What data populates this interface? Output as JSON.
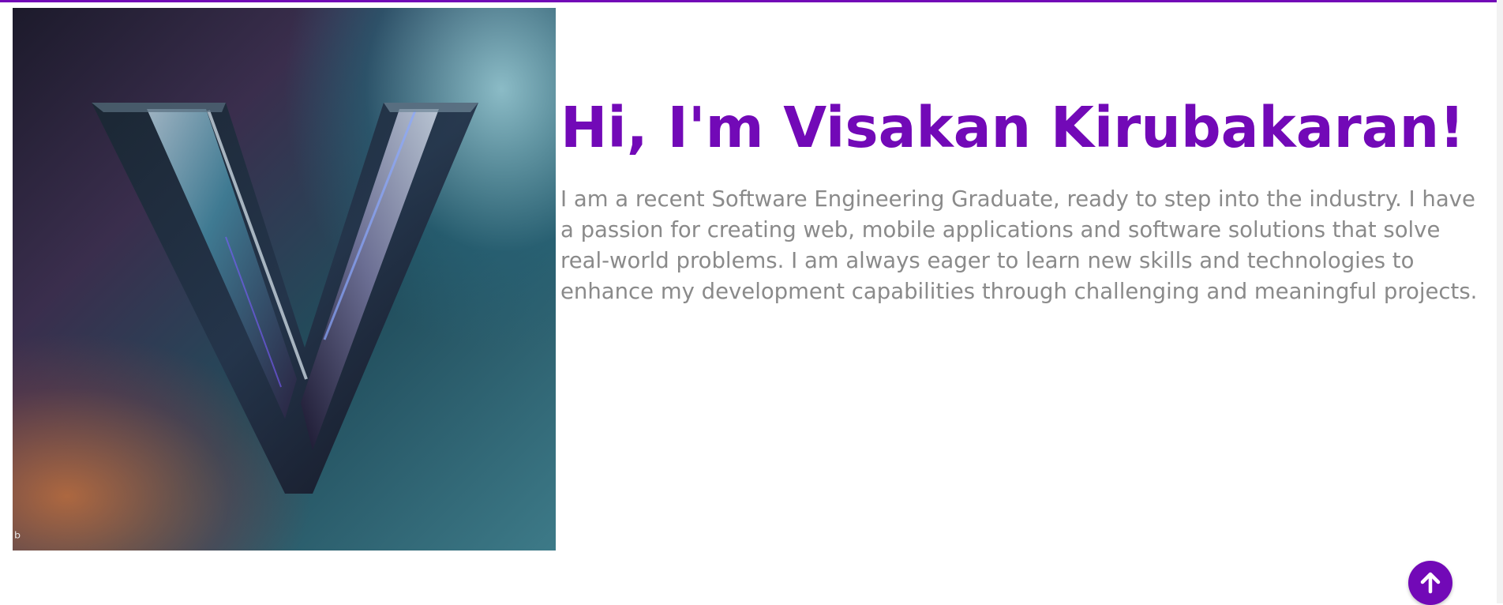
{
  "hero": {
    "title": "Hi, I'm Visakan Kirubakaran!",
    "bio": "I am a recent Software Engineering Graduate, ready to step into the industry. I have a passion for creating web, mobile applications and software solutions that solve real-world problems. I am always eager to learn new skills and technologies to enhance my development capabilities through challenging and meaningful projects.",
    "logo_icon": "v-logo-icon"
  },
  "scroll_top": {
    "icon": "arrow-up-icon"
  },
  "colors": {
    "accent": "#7209b7",
    "body_text": "#8a8a8a",
    "background": "#ffffff"
  }
}
